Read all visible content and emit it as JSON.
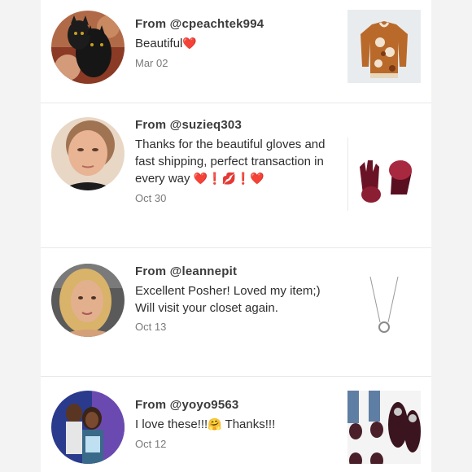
{
  "reviews": [
    {
      "from": "From @cpeachtek994",
      "message": "Beautiful",
      "emoji": "❤️",
      "date": "Mar 02",
      "avatar_icon": "cat-photo-avatar",
      "product_icon": "sweater-thumbnail"
    },
    {
      "from": "From @suzieq303",
      "message": "Thanks for the beautiful gloves and fast shipping, perfect transaction in every way",
      "emoji": "❤️❗💋❗❤️",
      "date": "Oct 30",
      "avatar_icon": "woman-photo-avatar",
      "product_icon": "gloves-thumbnail"
    },
    {
      "from": "From @leannepit",
      "message": "Excellent Posher! Loved my item;) Will visit your closet again.",
      "emoji": "",
      "date": "Oct 13",
      "avatar_icon": "blonde-woman-avatar",
      "product_icon": "necklace-thumbnail"
    },
    {
      "from": "From @yoyo9563",
      "message": "I love these!!!",
      "emoji": "🤗",
      "message_tail": " Thanks!!!",
      "date": "Oct 12",
      "avatar_icon": "couple-photo-avatar",
      "product_icon": "flats-thumbnail"
    }
  ],
  "colors": {
    "background": "#f3f3f3",
    "card": "#ffffff",
    "heart": "#d81c2c",
    "divider": "#e8e8e8"
  }
}
